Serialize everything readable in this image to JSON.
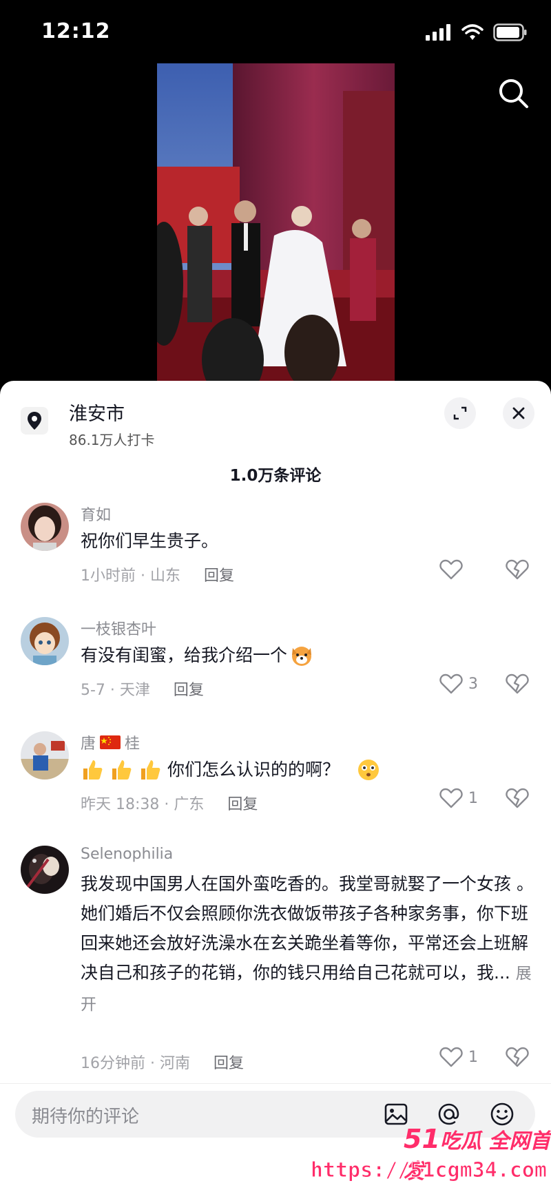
{
  "status": {
    "time": "12:12"
  },
  "location": {
    "title": "淮安市",
    "subtitle": "86.1万人打卡"
  },
  "comments_header": "1.0万条评论",
  "comments": [
    {
      "name": "育如",
      "text": "祝你们早生贵子。",
      "time": "1小时前 · 山东",
      "reply": "回复",
      "likes": ""
    },
    {
      "name": "一枝银杏叶",
      "text": "有没有闺蜜，给我介绍一个",
      "time": "5-7 · 天津",
      "reply": "回复",
      "likes": "3"
    },
    {
      "name_a": "唐",
      "name_b": "桂",
      "text": "你们怎么认识的的啊？",
      "time": "昨天 18:38 · 广东",
      "reply": "回复",
      "likes": "1"
    },
    {
      "name": "Selenophilia",
      "text": "我发现中国男人在国外蛮吃香的。我堂哥就娶了一个女孩 。她们婚后不仅会照顾你洗衣做饭带孩子各种家务事，你下班回来她还会放好洗澡水在玄关跪坐着等你，平常还会上班解决自己和孩子的花销，你的钱只用给自己花就可以，我...",
      "more": "展开",
      "time": "16分钟前 · 河南",
      "reply": "回复",
      "likes": "1"
    }
  ],
  "input": {
    "placeholder": "期待你的评论"
  },
  "watermark": {
    "logo_num": "51",
    "logo_text": "吃瓜 全网首发",
    "url": "https://51cgm34.com"
  },
  "icons": [
    "signal-icon",
    "wifi-icon",
    "battery-icon",
    "search-icon",
    "location-pin-icon",
    "expand-icon",
    "close-icon",
    "heart-icon",
    "broken-heart-icon",
    "image-icon",
    "at-icon",
    "emoji-icon",
    "dog-emoji",
    "thumbs-up-emoji",
    "china-flag-emoji",
    "flushed-emoji"
  ]
}
